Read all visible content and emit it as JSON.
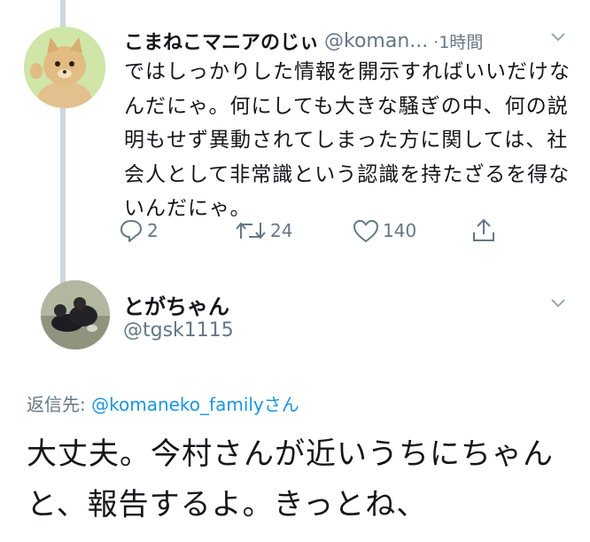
{
  "tweet1": {
    "author_name": "こまねこマニアのじぃ",
    "handle": "@koman...",
    "time": "·1時間",
    "text": "ではしっかりした情報を開示すればいいだけなんだにゃ。何にしても大きな騒ぎの中、何の説明もせず異動されてしまった方に関しては、社会人として非常識という認識を持たざるを得ないんだにゃ。",
    "actions": {
      "reply_count": "2",
      "retweet_count": "24",
      "like_count": "140"
    }
  },
  "tweet2": {
    "author_name": "とがちゃん",
    "handle": "@tgsk1115",
    "reply_to_label": "返信先:",
    "reply_to_handle": "@komaneko_family",
    "reply_to_suffix": "さん",
    "text": "大丈夫。今村さんが近いうちにちゃんと、報告するよ。きっとね、"
  },
  "colors": {
    "secondary_text": "#657786",
    "link": "#1b95e0",
    "thread_line": "#ccd6dd"
  },
  "icons": [
    "reply-icon",
    "retweet-icon",
    "like-icon",
    "share-icon",
    "chevron-down-icon"
  ]
}
